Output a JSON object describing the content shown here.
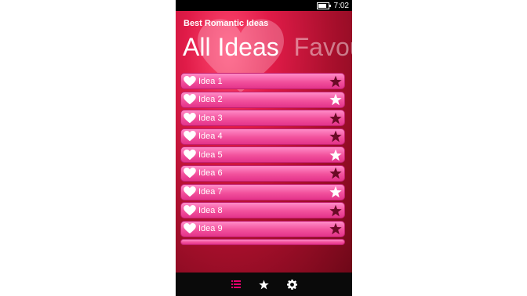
{
  "status": {
    "time": "7:02",
    "battery_level": 0.85
  },
  "app": {
    "title": "Best Romantic Ideas"
  },
  "pivot": {
    "tabs": [
      {
        "label": "All Ideas"
      },
      {
        "label": "Favourites"
      }
    ]
  },
  "ideas": [
    {
      "label": "Idea 1",
      "favourite": false
    },
    {
      "label": "Idea 2",
      "favourite": true
    },
    {
      "label": "Idea 3",
      "favourite": false
    },
    {
      "label": "Idea 4",
      "favourite": false
    },
    {
      "label": "Idea 5",
      "favourite": true
    },
    {
      "label": "Idea 6",
      "favourite": false
    },
    {
      "label": "Idea 7",
      "favourite": true
    },
    {
      "label": "Idea 8",
      "favourite": false
    },
    {
      "label": "Idea 9",
      "favourite": false
    }
  ],
  "appbar": {
    "buttons": [
      {
        "icon": "list-icon",
        "color": "#e8006e"
      },
      {
        "icon": "star-icon",
        "color": "#ffffff"
      },
      {
        "icon": "gear-icon",
        "color": "#ffffff"
      }
    ]
  },
  "colors": {
    "accent": "#e8006e",
    "row_pink": "#f2519c",
    "star_filled": "#6a0a26",
    "star_light": "#ffffff"
  }
}
